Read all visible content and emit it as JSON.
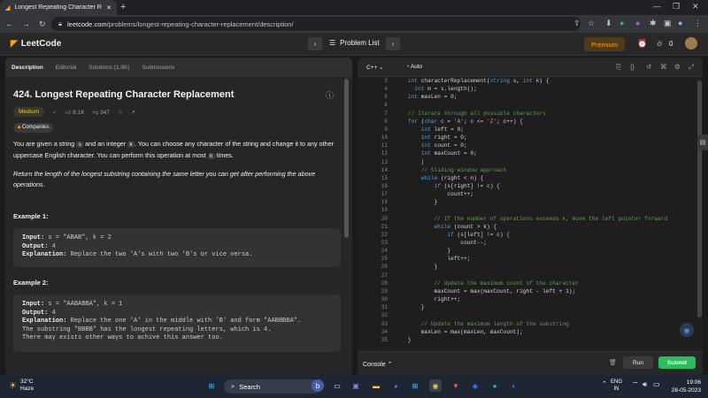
{
  "browser": {
    "tab_title": "Longest Repeating Character Re",
    "url_host": "leetcode.com",
    "url_path": "/problems/longest-repeating-character-replacement/description/"
  },
  "header": {
    "logo": "LeetCode",
    "problem_list": "Problem List",
    "premium": "Premium",
    "streak": "0"
  },
  "left_tabs": [
    "Description",
    "Editorial",
    "Solutions (1.8K)",
    "Submissions"
  ],
  "problem": {
    "title": "424. Longest Repeating Character Replacement",
    "difficulty": "Medium",
    "likes": "8.1K",
    "dislikes": "347",
    "companies": "Companies",
    "desc1_a": "You are given a string ",
    "desc1_s": "s",
    "desc1_b": " and an integer ",
    "desc1_k": "k",
    "desc1_c": ". You can choose any character of the string and change it to any other uppercase English character. You can perform this operation at most ",
    "desc1_k2": "k",
    "desc1_d": " times.",
    "desc2": "Return the length of the longest substring containing the same letter you can get after performing the above operations."
  },
  "examples": [
    {
      "heading": "Example 1:",
      "input_label": "Input:",
      "input": " s = \"ABAB\", k = 2",
      "output_label": "Output:",
      "output": " 4",
      "expl_label": "Explanation:",
      "expl": " Replace the two 'A's with two 'B's or vice versa."
    },
    {
      "heading": "Example 2:",
      "input_label": "Input:",
      "input": " s = \"AABABBA\", k = 1",
      "output_label": "Output:",
      "output": " 4",
      "expl_label": "Explanation:",
      "expl": " Replace the one 'A' in the middle with 'B' and form \"AABBBBA\".\nThe substring \"BBBB\" has the longest repeating letters, which is 4.\nThere may exists other ways to achive this answer too."
    }
  ],
  "editor": {
    "language": "C++",
    "mode": "Auto",
    "lines": [
      {
        "n": "3",
        "code": "    int characterReplacement(string s, int k) {"
      },
      {
        "n": "4",
        "code": "      int m = s.length();"
      },
      {
        "n": "5",
        "code": "    int maxLen = 0;"
      },
      {
        "n": "6",
        "code": ""
      },
      {
        "n": "7",
        "code": "    // Iterate through all possible characters"
      },
      {
        "n": "8",
        "code": "    for (char c = 'A'; c <= 'Z'; c++) {"
      },
      {
        "n": "9",
        "code": "        int left = 0;"
      },
      {
        "n": "10",
        "code": "        int right = 0;"
      },
      {
        "n": "11",
        "code": "        int count = 0;"
      },
      {
        "n": "12",
        "code": "        int maxCount = 0;"
      },
      {
        "n": "13",
        "code": "        |"
      },
      {
        "n": "14",
        "code": "        // Sliding window approach"
      },
      {
        "n": "15",
        "code": "        while (right < n) {"
      },
      {
        "n": "16",
        "code": "            if (s[right] != c) {"
      },
      {
        "n": "17",
        "code": "                count++;"
      },
      {
        "n": "18",
        "code": "            }"
      },
      {
        "n": "19",
        "code": ""
      },
      {
        "n": "20",
        "code": "            // If the number of operations exceeds k, move the left pointer forward"
      },
      {
        "n": "21",
        "code": "            while (count > k) {"
      },
      {
        "n": "22",
        "code": "                if (s[left] != c) {"
      },
      {
        "n": "23",
        "code": "                    count--;"
      },
      {
        "n": "24",
        "code": "                }"
      },
      {
        "n": "25",
        "code": "                left++;"
      },
      {
        "n": "26",
        "code": "            }"
      },
      {
        "n": "27",
        "code": ""
      },
      {
        "n": "28",
        "code": "            // Update the maximum count of the character"
      },
      {
        "n": "29",
        "code": "            maxCount = max(maxCount, right - left + 1);"
      },
      {
        "n": "30",
        "code": "            right++;"
      },
      {
        "n": "31",
        "code": "        }"
      },
      {
        "n": "32",
        "code": ""
      },
      {
        "n": "33",
        "code": "        // Update the maximum length of the substring"
      },
      {
        "n": "34",
        "code": "        maxLen = max(maxLen, maxCount);"
      },
      {
        "n": "35",
        "code": "    }"
      }
    ]
  },
  "console": {
    "label": "Console",
    "run": "Run",
    "submit": "Submit"
  },
  "taskbar": {
    "temp": "32°C",
    "weather": "Haze",
    "search": "Search",
    "lang": "ENG",
    "region": "IN",
    "time": "19:06",
    "date": "28-05-2023"
  },
  "colors": {
    "accent_orange": "#ffa116",
    "medium_yellow": "#ffc01e",
    "submit_green": "#2cbb5d",
    "comment_green": "#6a9955",
    "keyword_blue": "#569cd6"
  }
}
